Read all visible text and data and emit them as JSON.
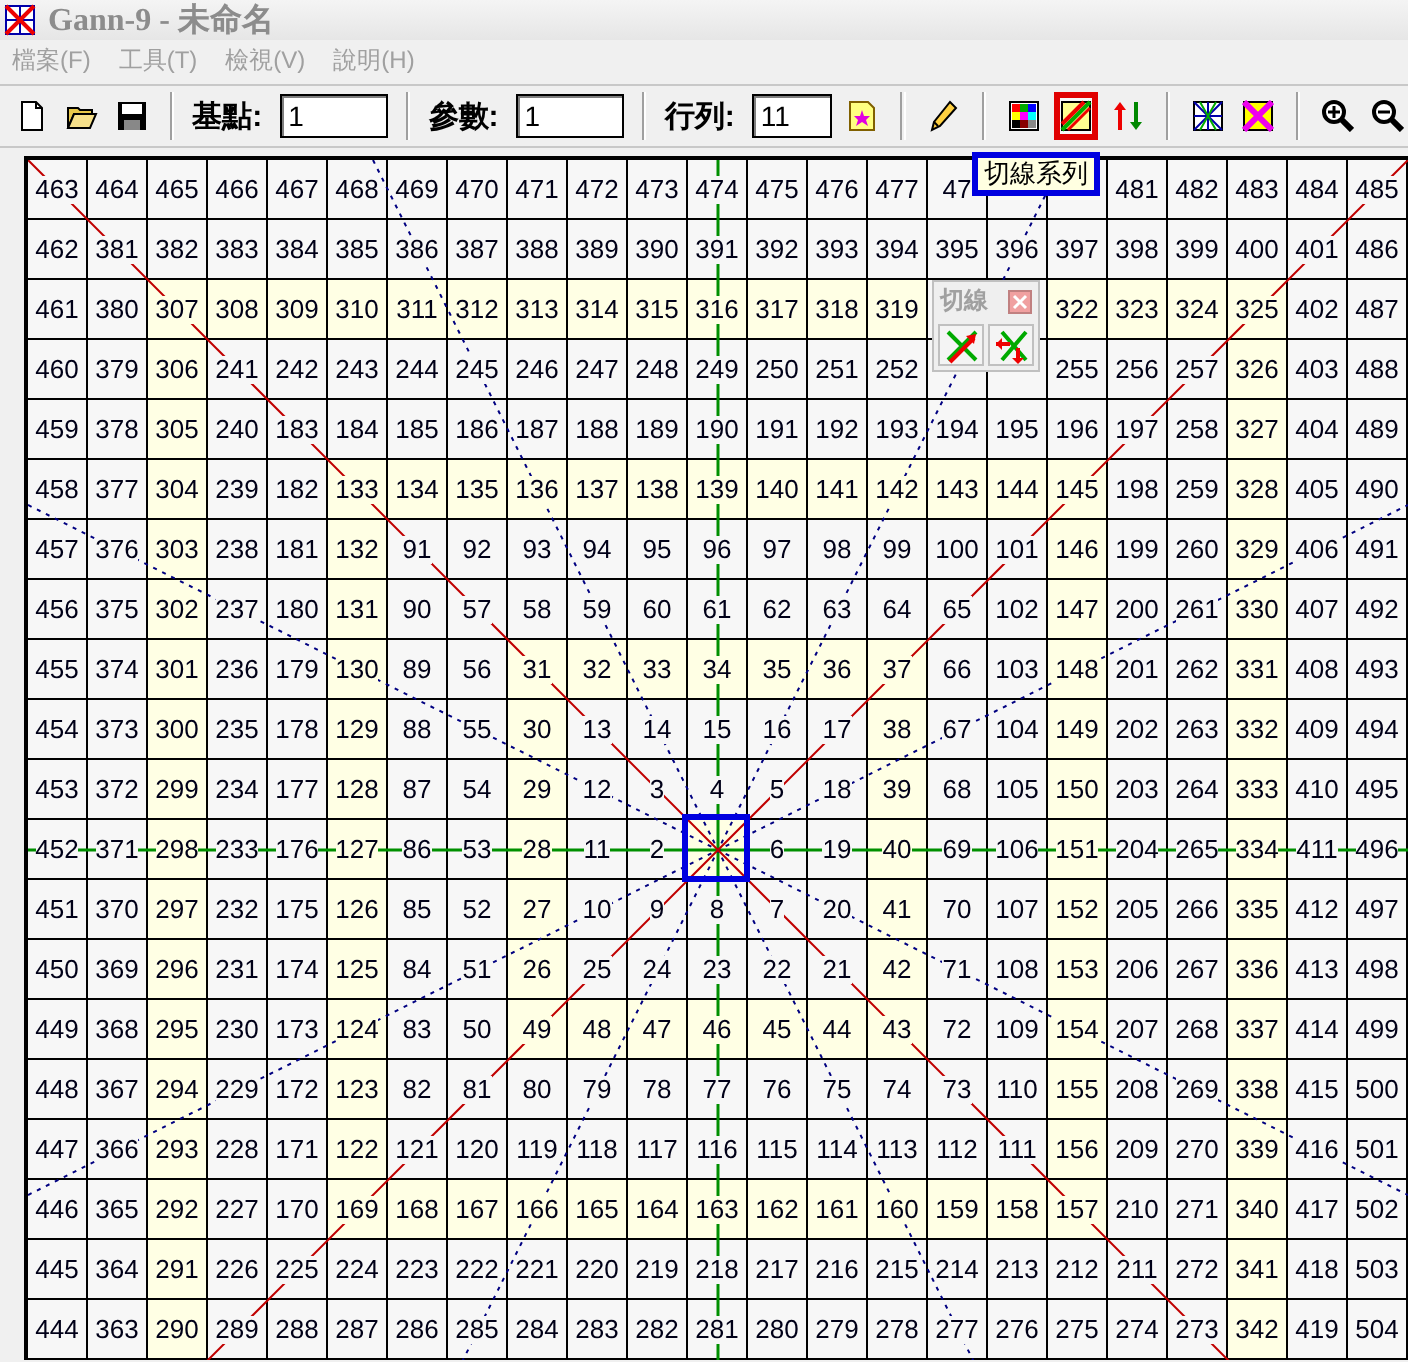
{
  "window": {
    "title": "Gann-9 - 未命名"
  },
  "menu": [
    {
      "label": "檔案(F)",
      "disabled": true
    },
    {
      "label": "工具(T)",
      "disabled": true
    },
    {
      "label": "檢視(V)",
      "disabled": true
    },
    {
      "label": "說明(H)",
      "disabled": true
    }
  ],
  "toolbar": {
    "items": [
      {
        "kind": "new",
        "selected": false
      },
      {
        "kind": "open",
        "selected": false
      },
      {
        "kind": "save",
        "selected": false
      },
      {
        "kind": "separator"
      },
      {
        "kind": "field",
        "label": "基點:",
        "value": "1"
      },
      {
        "kind": "separator"
      },
      {
        "kind": "field",
        "label": "參數:",
        "value": "1"
      },
      {
        "kind": "separator"
      },
      {
        "kind": "field",
        "label": "行列:",
        "value": "11"
      },
      {
        "kind": "note",
        "selected": false
      },
      {
        "kind": "separator"
      },
      {
        "kind": "pencil",
        "selected": false
      },
      {
        "kind": "separator"
      },
      {
        "kind": "colors",
        "selected": false
      },
      {
        "kind": "cut-lines",
        "selected": true
      },
      {
        "kind": "arrows",
        "selected": false
      },
      {
        "kind": "separator"
      },
      {
        "kind": "star-grid",
        "selected": false
      },
      {
        "kind": "x-grid",
        "selected": false
      },
      {
        "kind": "separator"
      },
      {
        "kind": "zoom-in",
        "selected": false
      },
      {
        "kind": "zoom-out",
        "selected": false
      }
    ]
  },
  "tooltip": {
    "text": "切線系列"
  },
  "palette": {
    "title": "切線",
    "buttons": [
      {
        "kind": "add-line"
      },
      {
        "kind": "remove-line"
      }
    ]
  },
  "grid": {
    "center_marker": {
      "selected": true
    },
    "rows": [
      {
        "cells": [
          "463",
          "464",
          "465",
          "466",
          "467",
          "468",
          "469",
          "470",
          "471",
          "472",
          "473",
          "474",
          "475",
          "476",
          "477",
          "47",
          null,
          null,
          "481",
          "482",
          "483",
          "484",
          "485"
        ],
        "shaded": [
          false,
          false,
          false,
          false,
          false,
          false,
          false,
          false,
          false,
          false,
          false,
          false,
          false,
          false,
          false,
          false,
          false,
          false,
          false,
          false,
          false,
          false,
          false
        ]
      },
      {
        "cells": [
          "462",
          "381",
          "382",
          "383",
          "384",
          "385",
          "386",
          "387",
          "388",
          "389",
          "390",
          "391",
          "392",
          "393",
          "394",
          "395",
          "396",
          "397",
          "398",
          "399",
          "400",
          "401",
          "486"
        ],
        "shaded": [
          false,
          false,
          false,
          false,
          false,
          false,
          false,
          false,
          false,
          false,
          false,
          false,
          false,
          false,
          false,
          false,
          false,
          false,
          false,
          false,
          false,
          false,
          false
        ]
      },
      {
        "cells": [
          "461",
          "380",
          "307",
          "308",
          "309",
          "310",
          "311",
          "312",
          "313",
          "314",
          "315",
          "316",
          "317",
          "318",
          "319",
          null,
          null,
          "322",
          "323",
          "324",
          "325",
          "402",
          "487"
        ],
        "shaded": [
          false,
          false,
          true,
          true,
          true,
          true,
          true,
          true,
          true,
          true,
          true,
          true,
          true,
          true,
          true,
          false,
          false,
          true,
          true,
          true,
          true,
          false,
          false
        ]
      },
      {
        "cells": [
          "460",
          "379",
          "306",
          "241",
          "242",
          "243",
          "244",
          "245",
          "246",
          "247",
          "248",
          "249",
          "250",
          "251",
          "252",
          null,
          null,
          "255",
          "256",
          "257",
          "326",
          "403",
          "488"
        ],
        "shaded": [
          false,
          false,
          true,
          false,
          false,
          false,
          false,
          false,
          false,
          false,
          false,
          false,
          false,
          false,
          false,
          false,
          false,
          false,
          false,
          false,
          true,
          false,
          false
        ]
      },
      {
        "cells": [
          "459",
          "378",
          "305",
          "240",
          "183",
          "184",
          "185",
          "186",
          "187",
          "188",
          "189",
          "190",
          "191",
          "192",
          "193",
          "194",
          "195",
          "196",
          "197",
          "258",
          "327",
          "404",
          "489"
        ],
        "shaded": [
          false,
          false,
          true,
          false,
          false,
          false,
          false,
          false,
          false,
          false,
          false,
          false,
          false,
          false,
          false,
          false,
          false,
          false,
          false,
          false,
          true,
          false,
          false
        ]
      },
      {
        "cells": [
          "458",
          "377",
          "304",
          "239",
          "182",
          "133",
          "134",
          "135",
          "136",
          "137",
          "138",
          "139",
          "140",
          "141",
          "142",
          "143",
          "144",
          "145",
          "198",
          "259",
          "328",
          "405",
          "490"
        ],
        "shaded": [
          false,
          false,
          true,
          false,
          false,
          true,
          true,
          true,
          true,
          true,
          true,
          true,
          true,
          true,
          true,
          true,
          true,
          true,
          false,
          false,
          true,
          false,
          false
        ]
      },
      {
        "cells": [
          "457",
          "376",
          "303",
          "238",
          "181",
          "132",
          "91",
          "92",
          "93",
          "94",
          "95",
          "96",
          "97",
          "98",
          "99",
          "100",
          "101",
          "146",
          "199",
          "260",
          "329",
          "406",
          "491"
        ],
        "shaded": [
          false,
          false,
          true,
          false,
          false,
          true,
          false,
          false,
          false,
          false,
          false,
          false,
          false,
          false,
          false,
          false,
          false,
          true,
          false,
          false,
          true,
          false,
          false
        ]
      },
      {
        "cells": [
          "456",
          "375",
          "302",
          "237",
          "180",
          "131",
          "90",
          "57",
          "58",
          "59",
          "60",
          "61",
          "62",
          "63",
          "64",
          "65",
          "102",
          "147",
          "200",
          "261",
          "330",
          "407",
          "492"
        ],
        "shaded": [
          false,
          false,
          true,
          false,
          false,
          true,
          false,
          false,
          false,
          false,
          false,
          false,
          false,
          false,
          false,
          false,
          false,
          true,
          false,
          false,
          true,
          false,
          false
        ]
      },
      {
        "cells": [
          "455",
          "374",
          "301",
          "236",
          "179",
          "130",
          "89",
          "56",
          "31",
          "32",
          "33",
          "34",
          "35",
          "36",
          "37",
          "66",
          "103",
          "148",
          "201",
          "262",
          "331",
          "408",
          "493"
        ],
        "shaded": [
          false,
          false,
          true,
          false,
          false,
          true,
          false,
          false,
          true,
          true,
          true,
          true,
          true,
          true,
          true,
          false,
          false,
          true,
          false,
          false,
          true,
          false,
          false
        ]
      },
      {
        "cells": [
          "454",
          "373",
          "300",
          "235",
          "178",
          "129",
          "88",
          "55",
          "30",
          "13",
          "14",
          "15",
          "16",
          "17",
          "38",
          "67",
          "104",
          "149",
          "202",
          "263",
          "332",
          "409",
          "494"
        ],
        "shaded": [
          false,
          false,
          true,
          false,
          false,
          true,
          false,
          false,
          true,
          false,
          false,
          false,
          false,
          false,
          true,
          false,
          false,
          true,
          false,
          false,
          true,
          false,
          false
        ]
      },
      {
        "cells": [
          "453",
          "372",
          "299",
          "234",
          "177",
          "128",
          "87",
          "54",
          "29",
          "12",
          "3",
          "4",
          "5",
          "18",
          "39",
          "68",
          "105",
          "150",
          "203",
          "264",
          "333",
          "410",
          "495"
        ],
        "shaded": [
          false,
          false,
          true,
          false,
          false,
          true,
          false,
          false,
          true,
          false,
          false,
          false,
          false,
          false,
          true,
          false,
          false,
          true,
          false,
          false,
          true,
          false,
          false
        ]
      },
      {
        "cells": [
          "452",
          "371",
          "298",
          "233",
          "176",
          "127",
          "86",
          "53",
          "28",
          "11",
          "2",
          null,
          "6",
          "19",
          "40",
          "69",
          "106",
          "151",
          "204",
          "265",
          "334",
          "411",
          "496"
        ],
        "shaded": [
          false,
          false,
          true,
          false,
          false,
          true,
          false,
          false,
          true,
          false,
          false,
          true,
          false,
          false,
          true,
          false,
          false,
          true,
          false,
          false,
          true,
          false,
          false
        ]
      },
      {
        "cells": [
          "451",
          "370",
          "297",
          "232",
          "175",
          "126",
          "85",
          "52",
          "27",
          "10",
          "9",
          "8",
          "7",
          "20",
          "41",
          "70",
          "107",
          "152",
          "205",
          "266",
          "335",
          "412",
          "497"
        ],
        "shaded": [
          false,
          false,
          true,
          false,
          false,
          true,
          false,
          false,
          true,
          false,
          false,
          false,
          false,
          false,
          true,
          false,
          false,
          true,
          false,
          false,
          true,
          false,
          false
        ]
      },
      {
        "cells": [
          "450",
          "369",
          "296",
          "231",
          "174",
          "125",
          "84",
          "51",
          "26",
          "25",
          "24",
          "23",
          "22",
          "21",
          "42",
          "71",
          "108",
          "153",
          "206",
          "267",
          "336",
          "413",
          "498"
        ],
        "shaded": [
          false,
          false,
          true,
          false,
          false,
          true,
          false,
          false,
          true,
          false,
          false,
          false,
          false,
          false,
          true,
          false,
          false,
          true,
          false,
          false,
          true,
          false,
          false
        ]
      },
      {
        "cells": [
          "449",
          "368",
          "295",
          "230",
          "173",
          "124",
          "83",
          "50",
          "49",
          "48",
          "47",
          "46",
          "45",
          "44",
          "43",
          "72",
          "109",
          "154",
          "207",
          "268",
          "337",
          "414",
          "499"
        ],
        "shaded": [
          false,
          false,
          true,
          false,
          false,
          true,
          false,
          false,
          true,
          true,
          true,
          true,
          true,
          true,
          true,
          false,
          false,
          true,
          false,
          false,
          true,
          false,
          false
        ]
      },
      {
        "cells": [
          "448",
          "367",
          "294",
          "229",
          "172",
          "123",
          "82",
          "81",
          "80",
          "79",
          "78",
          "77",
          "76",
          "75",
          "74",
          "73",
          "110",
          "155",
          "208",
          "269",
          "338",
          "415",
          "500"
        ],
        "shaded": [
          false,
          false,
          true,
          false,
          false,
          true,
          false,
          false,
          false,
          false,
          false,
          false,
          false,
          false,
          false,
          false,
          false,
          true,
          false,
          false,
          true,
          false,
          false
        ]
      },
      {
        "cells": [
          "447",
          "366",
          "293",
          "228",
          "171",
          "122",
          "121",
          "120",
          "119",
          "118",
          "117",
          "116",
          "115",
          "114",
          "113",
          "112",
          "111",
          "156",
          "209",
          "270",
          "339",
          "416",
          "501"
        ],
        "shaded": [
          false,
          false,
          true,
          false,
          false,
          true,
          false,
          false,
          false,
          false,
          false,
          false,
          false,
          false,
          false,
          false,
          false,
          true,
          false,
          false,
          true,
          false,
          false
        ]
      },
      {
        "cells": [
          "446",
          "365",
          "292",
          "227",
          "170",
          "169",
          "168",
          "167",
          "166",
          "165",
          "164",
          "163",
          "162",
          "161",
          "160",
          "159",
          "158",
          "157",
          "210",
          "271",
          "340",
          "417",
          "502"
        ],
        "shaded": [
          false,
          false,
          true,
          false,
          false,
          true,
          true,
          true,
          true,
          true,
          true,
          true,
          true,
          true,
          true,
          true,
          true,
          true,
          false,
          false,
          true,
          false,
          false
        ]
      },
      {
        "cells": [
          "445",
          "364",
          "291",
          "226",
          "225",
          "224",
          "223",
          "222",
          "221",
          "220",
          "219",
          "218",
          "217",
          "216",
          "215",
          "214",
          "213",
          "212",
          "211",
          "272",
          "341",
          "418",
          "503"
        ],
        "shaded": [
          false,
          false,
          true,
          false,
          false,
          false,
          false,
          false,
          false,
          false,
          false,
          false,
          false,
          false,
          false,
          false,
          false,
          false,
          false,
          false,
          true,
          false,
          false
        ]
      },
      {
        "cells": [
          "444",
          "363",
          "290",
          "289",
          "288",
          "287",
          "286",
          "285",
          "284",
          "283",
          "282",
          "281",
          "280",
          "279",
          "278",
          "277",
          "276",
          "275",
          "274",
          "273",
          "342",
          "419",
          "504"
        ],
        "shaded": [
          false,
          false,
          true,
          false,
          false,
          false,
          false,
          false,
          false,
          false,
          false,
          false,
          false,
          false,
          false,
          false,
          false,
          false,
          false,
          false,
          true,
          false,
          false
        ]
      }
    ]
  }
}
